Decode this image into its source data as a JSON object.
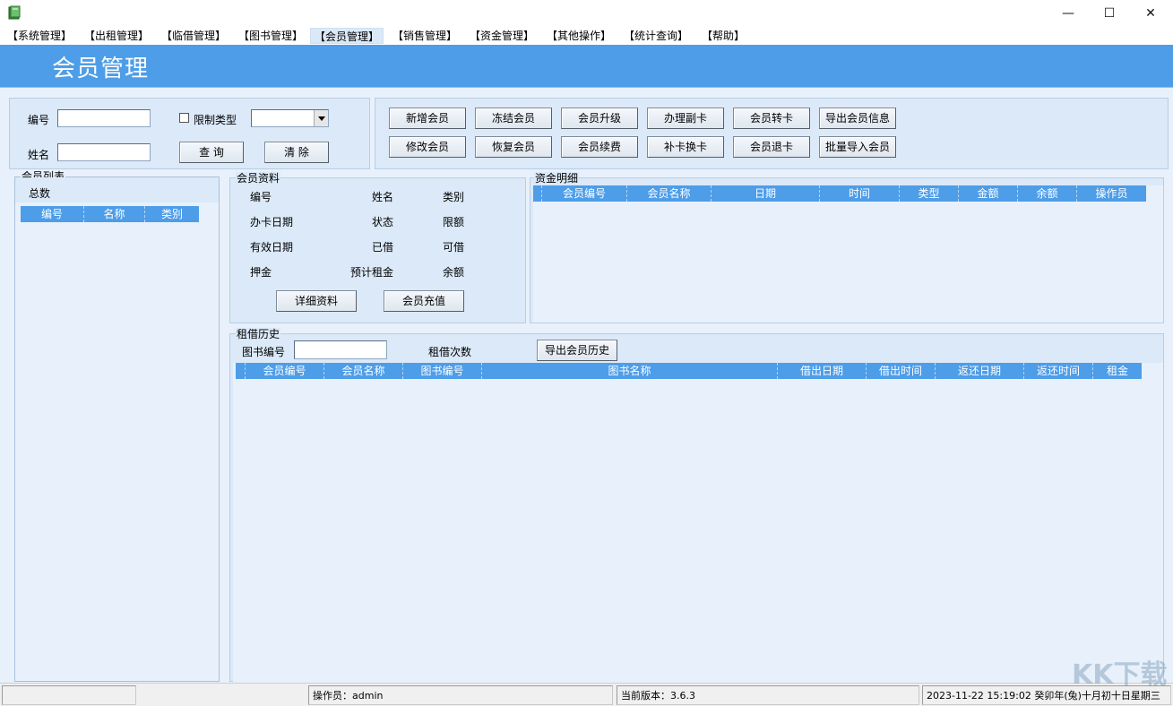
{
  "window": {
    "icon": "book-icon",
    "minimize": "—",
    "maximize": "☐",
    "close": "✕"
  },
  "menu": [
    "【系统管理】",
    "【出租管理】",
    "【临借管理】",
    "【图书管理】",
    "【会员管理】",
    "【销售管理】",
    "【资金管理】",
    "【其他操作】",
    "【统计查询】",
    "【帮助】"
  ],
  "active_menu": "【会员管理】",
  "banner": {
    "title": "会员管理",
    "color": "#4d9de8"
  },
  "search": {
    "id_label": "编号",
    "id_value": "",
    "restrict_label": "限制类型",
    "type_value": "",
    "name_label": "姓名",
    "name_value": "",
    "query_button": "查 询",
    "clear_button": "清 除"
  },
  "actions": {
    "row1": [
      "新增会员",
      "冻结会员",
      "会员升级",
      "办理副卡",
      "会员转卡",
      "导出会员信息"
    ],
    "row2": [
      "修改会员",
      "恢复会员",
      "会员续费",
      "补卡换卡",
      "会员退卡",
      "批量导入会员"
    ]
  },
  "member_list": {
    "title": "会员列表",
    "total_label": "总数",
    "columns": [
      "编号",
      "名称",
      "类别"
    ]
  },
  "member_info": {
    "title": "会员资料",
    "fields": [
      "编号",
      "姓名",
      "类别",
      "办卡日期",
      "状态",
      "限额",
      "有效日期",
      "已借",
      "可借",
      "押金",
      "预计租金",
      "余额"
    ],
    "detail_button": "详细资料",
    "recharge_button": "会员充值"
  },
  "fund_detail": {
    "title": "资金明细",
    "columns": [
      "会员编号",
      "会员名称",
      "日期",
      "时间",
      "类型",
      "金额",
      "余额",
      "操作员"
    ]
  },
  "rent_history": {
    "title": "租借历史",
    "book_id_label": "图书编号",
    "book_id_value": "",
    "count_label": "租借次数",
    "export_button": "导出会员历史",
    "columns": [
      "会员编号",
      "会员名称",
      "图书编号",
      "图书名称",
      "借出日期",
      "借出时间",
      "返还日期",
      "返还时间",
      "租金"
    ]
  },
  "status": {
    "operator": "操作员：admin",
    "version": "当前版本：3.6.3",
    "datetime": "2023-11-22 15:19:02 癸卯年(兔)十月初十日星期三"
  },
  "watermark": "KK下载"
}
